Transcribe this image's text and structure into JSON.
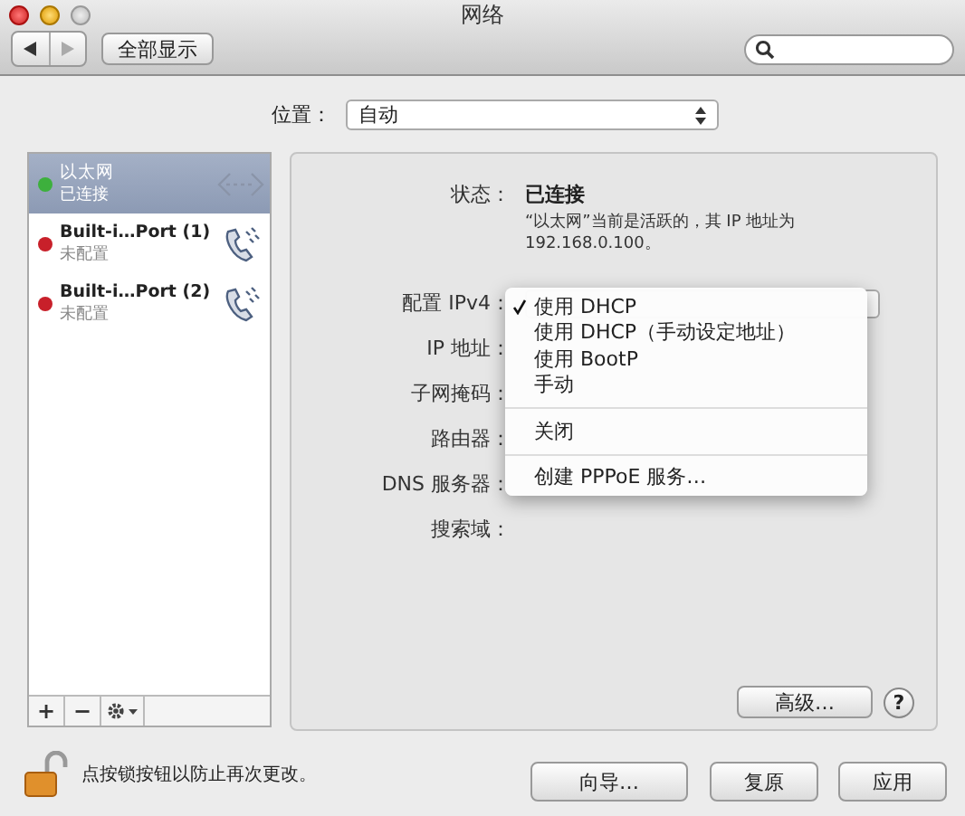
{
  "window": {
    "title": "网络"
  },
  "toolbar": {
    "show_all_button": "全部显示"
  },
  "location": {
    "label": "位置：",
    "value": "自动"
  },
  "services": [
    {
      "name": "以太网",
      "status": "已连接",
      "color": "#3db03d",
      "selected": true,
      "kind": "ethernet"
    },
    {
      "name": "Built-i…Port (1)",
      "status": "未配置",
      "color": "#c8202a",
      "selected": false,
      "kind": "modem"
    },
    {
      "name": "Built-i…Port (2)",
      "status": "未配置",
      "color": "#c8202a",
      "selected": false,
      "kind": "modem"
    }
  ],
  "list_toolbar": {
    "add_button": "+",
    "remove_button": "−"
  },
  "detail": {
    "status_label": "状态：",
    "status_value": "已连接",
    "status_description": "“以太网”当前是活跃的，其 IP 地址为 192.168.0.100。",
    "fields": [
      {
        "label": "配置 IPv4："
      },
      {
        "label": "IP 地址："
      },
      {
        "label": "子网掩码："
      },
      {
        "label": "路由器："
      },
      {
        "label": "DNS 服务器："
      },
      {
        "label": "搜索域："
      }
    ]
  },
  "ipv4_menu": {
    "items": [
      {
        "kind": "item",
        "label": "使用 DHCP",
        "checked": true
      },
      {
        "kind": "item",
        "label": "使用 DHCP（手动设定地址）",
        "checked": false
      },
      {
        "kind": "item",
        "label": "使用 BootP",
        "checked": false
      },
      {
        "kind": "item",
        "label": "手动",
        "checked": false
      },
      {
        "kind": "separator"
      },
      {
        "kind": "item",
        "label": "关闭",
        "checked": false
      },
      {
        "kind": "separator"
      },
      {
        "kind": "item",
        "label": "创建 PPPoE 服务…",
        "checked": false
      }
    ]
  },
  "advanced_button": "高级…",
  "help_button": "?",
  "lock": {
    "text": "点按锁按钮以防止再次更改。",
    "locked": false
  },
  "buttons": [
    "向导…",
    "复原",
    "应用"
  ]
}
